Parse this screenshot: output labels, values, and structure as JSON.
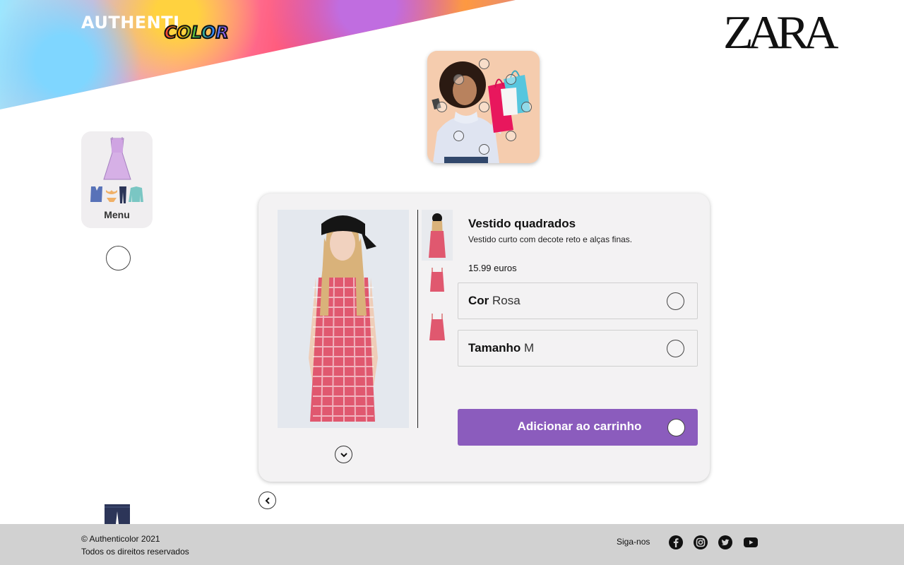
{
  "brand": {
    "logo_part1": "AUTHENTI",
    "logo_part2": "COLOR",
    "partner": "ZARA"
  },
  "menu": {
    "label": "Menu"
  },
  "product": {
    "title": "Vestido quadrados",
    "description": "Vestido curto com decote reto e alças finas.",
    "price": "15.99 euros",
    "color_label": "Cor",
    "color_value": "Rosa",
    "size_label": "Tamanho",
    "size_value": "M",
    "add_to_cart": "Adicionar ao carrinho"
  },
  "footer": {
    "copyright": "© Authenticolor 2021",
    "rights": "Todos os direitos reservados",
    "follow": "Siga-nos",
    "social_icons": [
      "facebook-icon",
      "instagram-icon",
      "twitter-icon",
      "youtube-icon"
    ]
  },
  "colors": {
    "accent": "#8b5cbd",
    "card_bg": "#f3f2f3",
    "footer_bg": "#d1d1d1"
  }
}
